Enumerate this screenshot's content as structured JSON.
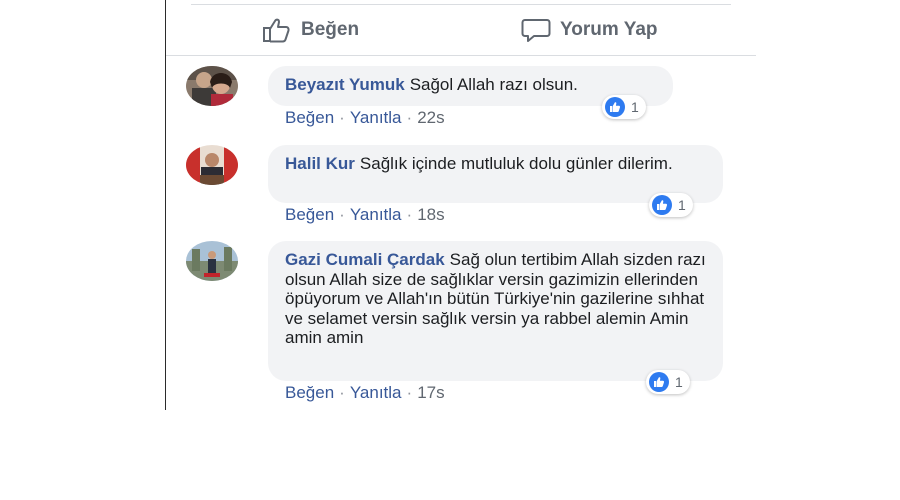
{
  "actions": {
    "like_label": "Beğen",
    "comment_label": "Yorum Yap",
    "like_icon": "thumbs-up-outline-icon",
    "comment_icon": "speech-bubble-icon"
  },
  "colors": {
    "author": "#385898",
    "bubble": "#f2f3f5",
    "like_badge": "#2e7bf0"
  },
  "comments": [
    {
      "author": "Beyazıt Yumuk",
      "text": "Sağol Allah razı olsun.",
      "like": "Beğen",
      "sep": "·",
      "reply": "Yanıtla",
      "sep2": "·",
      "time": "22s",
      "reaction_count": "1"
    },
    {
      "author": "Halil Kur",
      "text": "Sağlık içinde mutluluk dolu günler dilerim.",
      "like": "Beğen",
      "sep": "·",
      "reply": "Yanıtla",
      "sep2": "·",
      "time": "18s",
      "reaction_count": "1"
    },
    {
      "author": "Gazi Cumali Çardak",
      "text": "Sağ olun tertibim Allah sizden razı olsun Allah size de sağlıklar versin gazimizin ellerinden öpüyorum ve Allah'ın bütün Türkiye'nin gazilerine sıhhat ve selamet versin sağlık versin ya rabbel alemin Amin amin amin",
      "like": "Beğen",
      "sep": "·",
      "reply": "Yanıtla",
      "sep2": "·",
      "time": "17s",
      "reaction_count": "1"
    }
  ]
}
